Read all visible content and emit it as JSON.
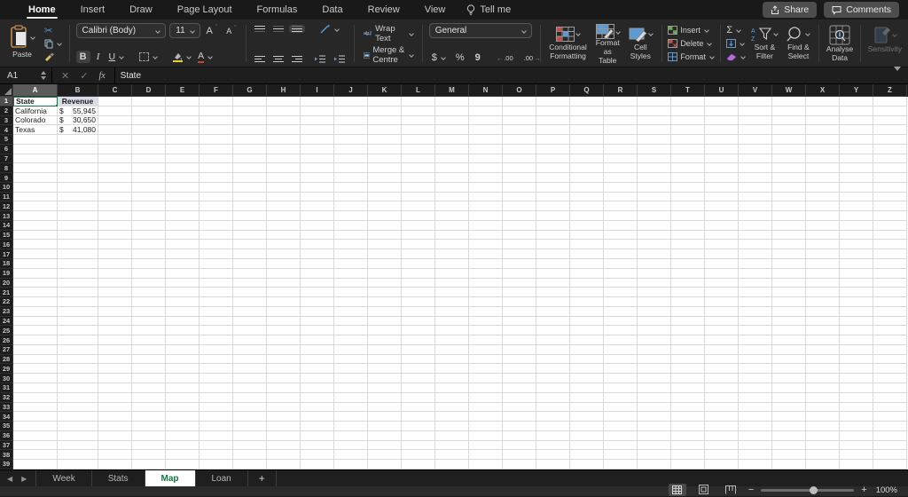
{
  "menubar": {
    "items": [
      {
        "label": "Home",
        "active": true
      },
      {
        "label": "Insert",
        "active": false
      },
      {
        "label": "Draw",
        "active": false
      },
      {
        "label": "Page Layout",
        "active": false
      },
      {
        "label": "Formulas",
        "active": false
      },
      {
        "label": "Data",
        "active": false
      },
      {
        "label": "Review",
        "active": false
      },
      {
        "label": "View",
        "active": false
      }
    ],
    "tell_me": "Tell me",
    "share": "Share",
    "comments": "Comments"
  },
  "ribbon": {
    "paste_label": "Paste",
    "font_name": "Calibri (Body)",
    "font_size": "11",
    "font_grow": "A",
    "font_shrink": "A",
    "bold": "B",
    "italic": "I",
    "underline": "U",
    "wrap_text": "Wrap Text",
    "merge_centre": "Merge & Centre",
    "number_format": "General",
    "currency": "$",
    "percent": "%",
    "comma": "9",
    "inc_decimal": ".00",
    "dec_decimal": ".00",
    "sigma": "Σ",
    "cond_fmt_1": "Conditional",
    "cond_fmt_2": "Formatting",
    "format_table_1": "Format",
    "format_table_2": "as Table",
    "cell_styles_1": "Cell",
    "cell_styles_2": "Styles",
    "insert": "Insert",
    "delete": "Delete",
    "format": "Format",
    "sort_1": "Sort &",
    "sort_2": "Filter",
    "find_1": "Find &",
    "find_2": "Select",
    "analyse_1": "Analyse",
    "analyse_2": "Data",
    "sensitivity": "Sensitivity"
  },
  "formula_bar": {
    "name_box": "A1",
    "fx": "fx",
    "content": "State"
  },
  "sheet": {
    "columns": [
      "A",
      "B",
      "C",
      "D",
      "E",
      "F",
      "G",
      "H",
      "I",
      "J",
      "K",
      "L",
      "M",
      "N",
      "O",
      "P",
      "Q",
      "R",
      "S",
      "T",
      "U",
      "V",
      "W",
      "X",
      "Y",
      "Z"
    ],
    "row_count": 39,
    "selected_cell": "A1",
    "selected_column": "A",
    "selected_row": 1,
    "header_fill": "#d9dce9",
    "cells": [
      {
        "row": 1,
        "col": "A",
        "text": "State",
        "bold": true,
        "selected": true
      },
      {
        "row": 1,
        "col": "B",
        "text": "Revenue",
        "bold": true,
        "fill": "#d9dce9",
        "align": "center"
      },
      {
        "row": 2,
        "col": "A",
        "text": "California"
      },
      {
        "row": 2,
        "col": "B",
        "currency": "$",
        "amount": "55,945"
      },
      {
        "row": 3,
        "col": "A",
        "text": "Colorado"
      },
      {
        "row": 3,
        "col": "B",
        "currency": "$",
        "amount": "30,650"
      },
      {
        "row": 4,
        "col": "A",
        "text": "Texas"
      },
      {
        "row": 4,
        "col": "B",
        "currency": "$",
        "amount": "41,080"
      }
    ]
  },
  "tabs": {
    "sheets": [
      {
        "label": "Week",
        "active": false
      },
      {
        "label": "Stats",
        "active": false
      },
      {
        "label": "Map",
        "active": true
      },
      {
        "label": "Loan",
        "active": false
      }
    ],
    "add": "+"
  },
  "statusbar": {
    "zoom": "100%"
  },
  "colors": {
    "accent_green": "#1e7145",
    "selection_green": "#1f7246",
    "header_fill": "#d9dce9"
  }
}
